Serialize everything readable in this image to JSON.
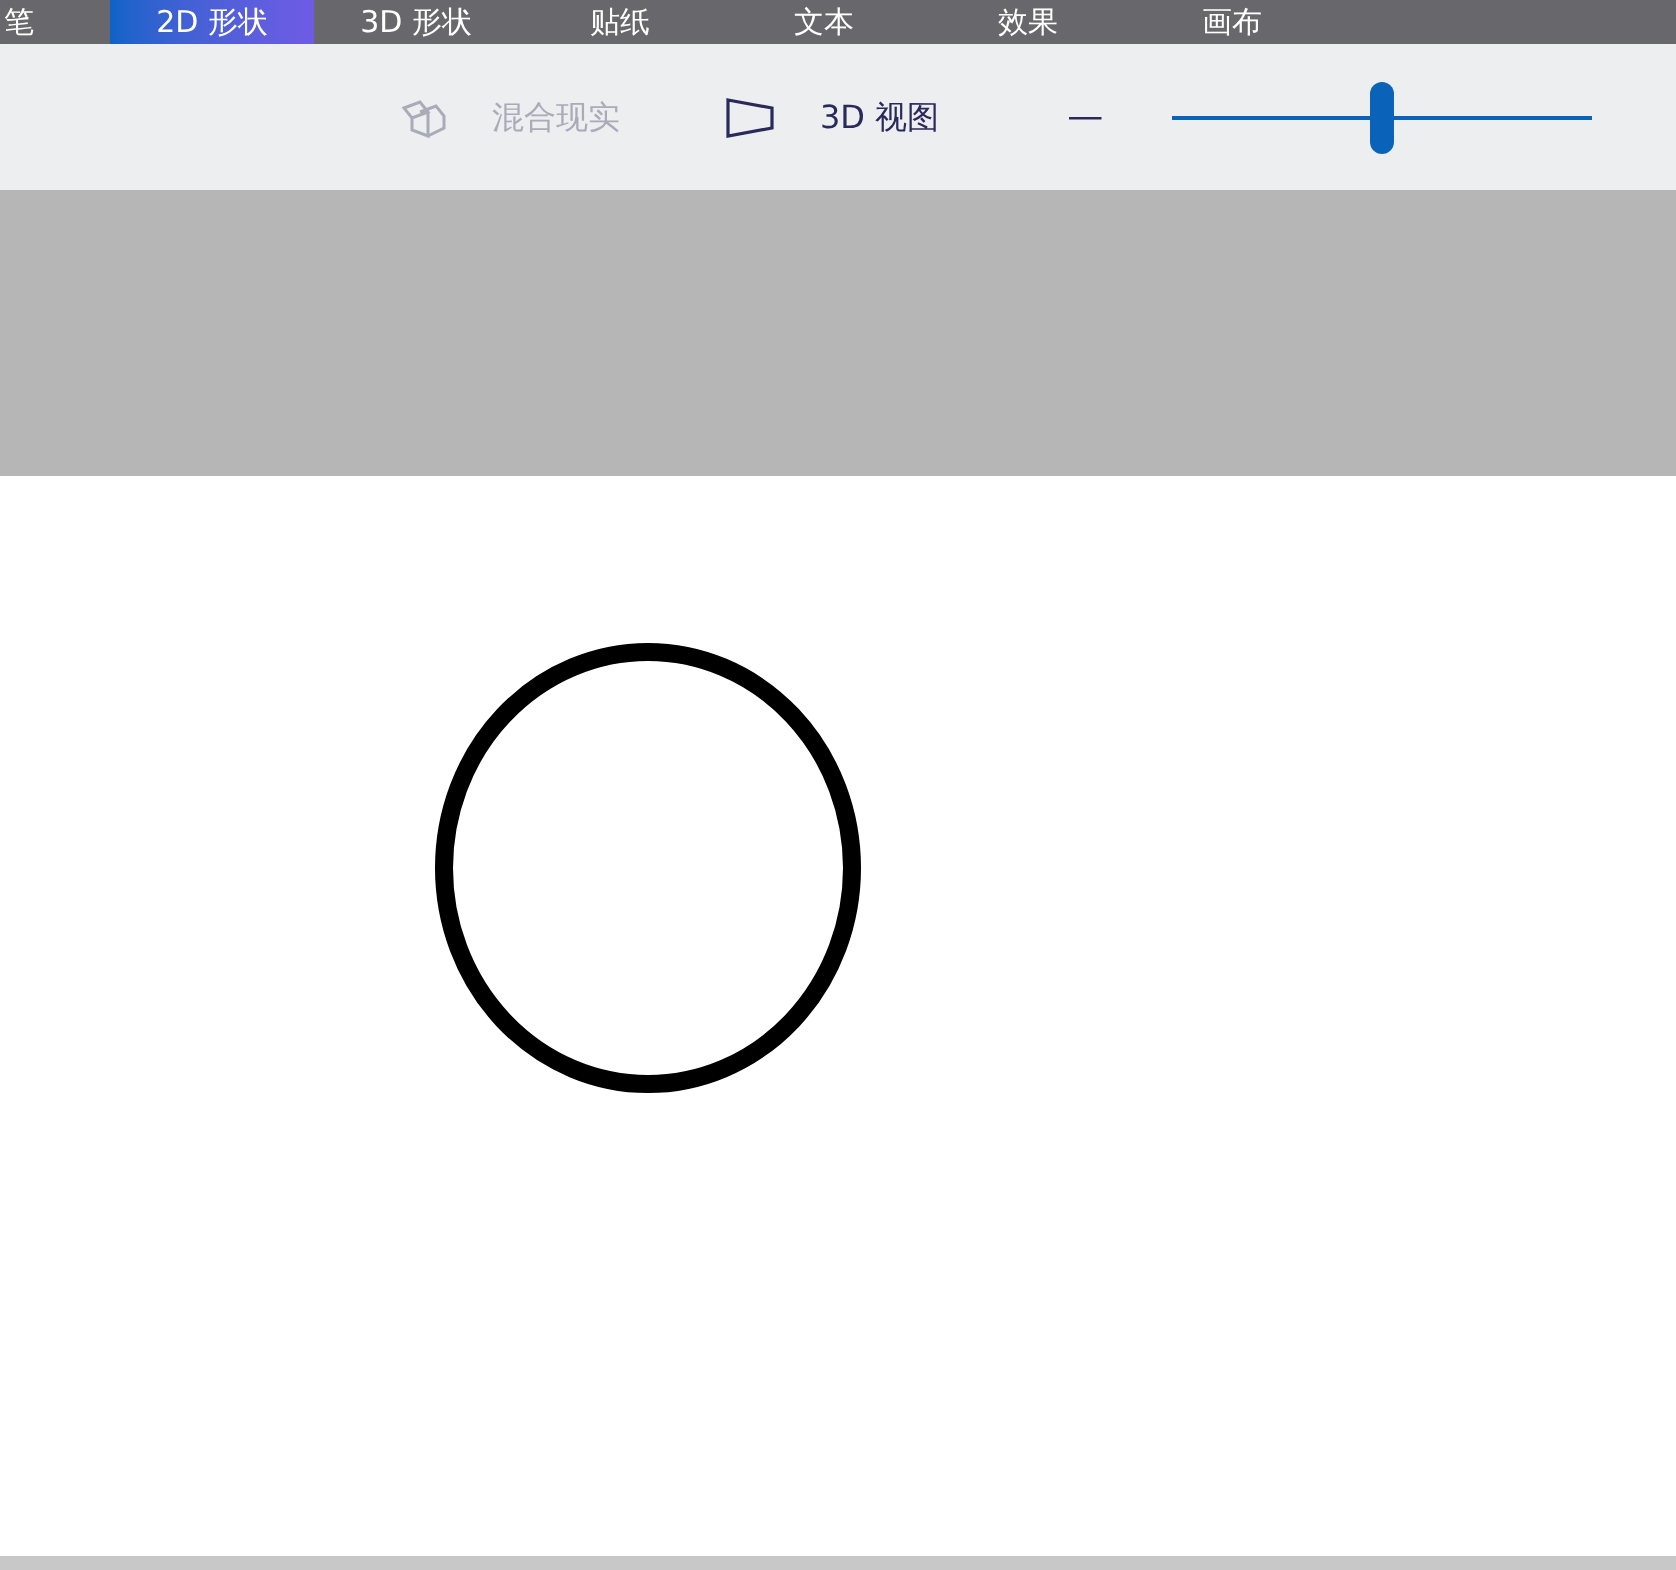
{
  "tabs": [
    {
      "label": "笔",
      "selected": false
    },
    {
      "label": "2D 形状",
      "selected": true
    },
    {
      "label": "3D 形状",
      "selected": false
    },
    {
      "label": "贴纸",
      "selected": false
    },
    {
      "label": "文本",
      "selected": false
    },
    {
      "label": "效果",
      "selected": false
    },
    {
      "label": "画布",
      "selected": false
    }
  ],
  "toolbar": {
    "mixed_reality": {
      "label": "混合现实",
      "disabled": true
    },
    "view_3d": {
      "label": "3D 视图",
      "disabled": false
    },
    "zoom_out": {
      "label": "—"
    },
    "zoom": {
      "level": 0.5
    }
  }
}
